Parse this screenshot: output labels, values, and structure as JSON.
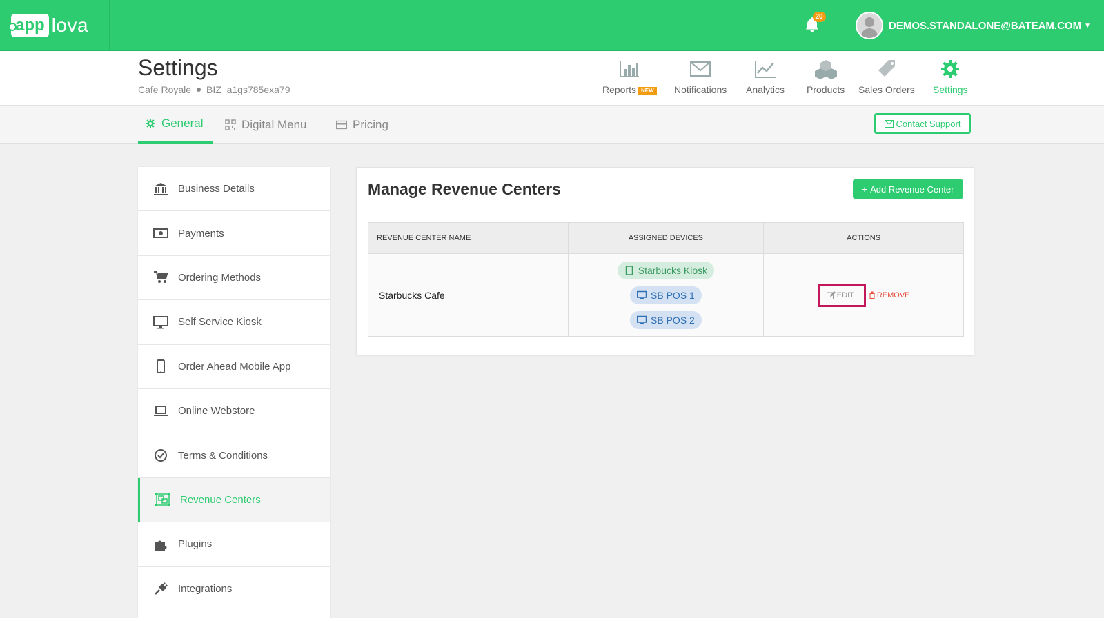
{
  "topbar": {
    "logo_box": "app",
    "logo_text": "lova",
    "notification_count": "20",
    "user_email": "DEMOS.STANDALONE@BATEAM.COM"
  },
  "header": {
    "title": "Settings",
    "business_name": "Cafe Royale",
    "business_id": "BIZ_a1gs785exa79",
    "nav": {
      "reports": "Reports",
      "reports_badge": "NEW",
      "notifications": "Notifications",
      "analytics": "Analytics",
      "products": "Products",
      "sales_orders": "Sales Orders",
      "settings": "Settings"
    }
  },
  "tabs": {
    "general": "General",
    "digital_menu": "Digital Menu",
    "pricing": "Pricing",
    "contact_support": "Contact Support"
  },
  "sidebar": {
    "items": [
      {
        "label": "Business Details",
        "icon": "bank-icon"
      },
      {
        "label": "Payments",
        "icon": "money-icon"
      },
      {
        "label": "Ordering Methods",
        "icon": "cart-icon"
      },
      {
        "label": "Self Service Kiosk",
        "icon": "monitor-icon"
      },
      {
        "label": "Order Ahead Mobile App",
        "icon": "mobile-icon"
      },
      {
        "label": "Online Webstore",
        "icon": "laptop-icon"
      },
      {
        "label": "Terms & Conditions",
        "icon": "check-circle-icon"
      },
      {
        "label": "Revenue Centers",
        "icon": "revenue-center-icon",
        "active": true
      },
      {
        "label": "Plugins",
        "icon": "puzzle-icon"
      },
      {
        "label": "Integrations",
        "icon": "plug-icon"
      }
    ]
  },
  "main": {
    "title": "Manage Revenue Centers",
    "add_button": "Add Revenue Center",
    "table": {
      "headers": [
        "REVENUE CENTER NAME",
        "ASSIGNED DEVICES",
        "ACTIONS"
      ],
      "rows": [
        {
          "name": "Starbucks Cafe",
          "devices": [
            "Starbucks Kiosk",
            "SB POS 1",
            "SB POS 2"
          ],
          "edit": "EDIT",
          "remove": "REMOVE"
        }
      ]
    }
  },
  "colors": {
    "brand": "#2ecc71",
    "highlight": "#c2185b",
    "danger": "#e74c3c",
    "badge": "#f39c12"
  }
}
